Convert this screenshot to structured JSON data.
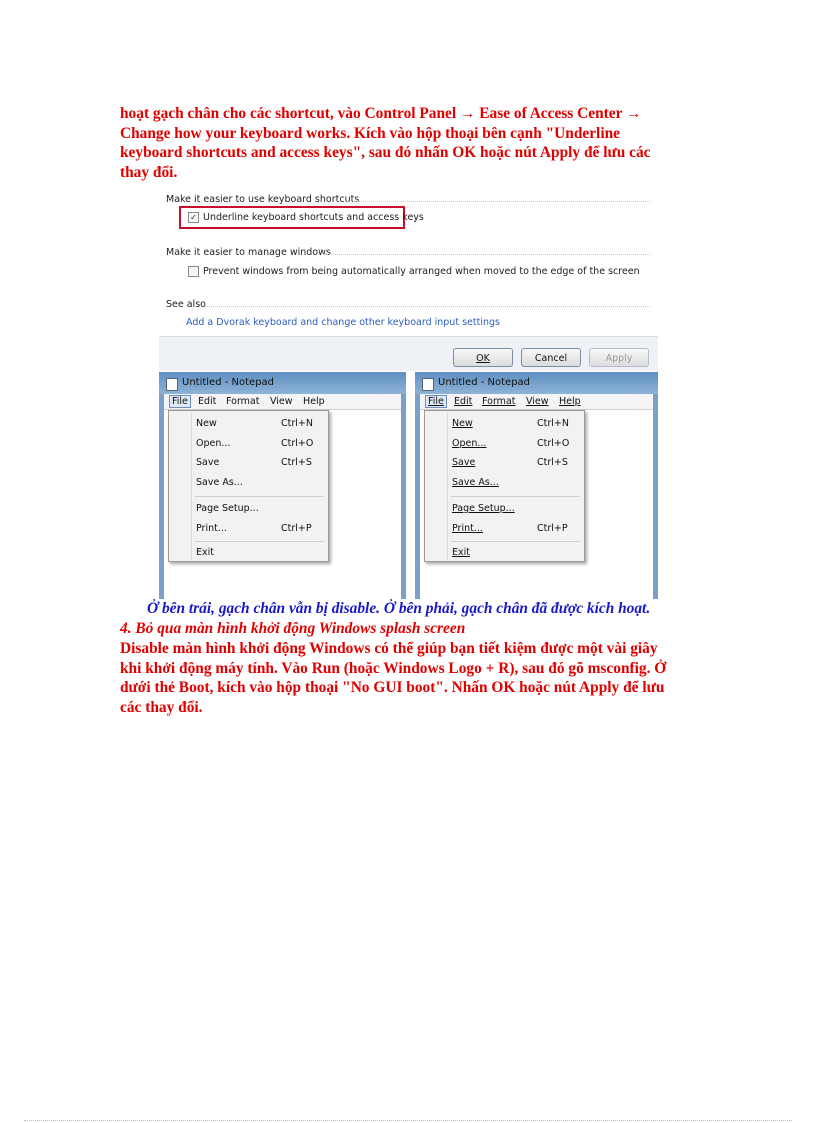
{
  "intro": {
    "line1": "hoạt gạch chân cho các shortcut, vào Control Panel → Ease of Access Center →",
    "line2": "Change how your keyboard works. Kích vào hộp thoại bên cạnh \"Underline",
    "line3": "keyboard shortcuts and access keys\", sau đó nhấn OK hoặc nút Apply để lưu các",
    "line4": "thay đổi."
  },
  "dialog": {
    "section1": "Make it easier to use keyboard shortcuts",
    "option1": "Underline keyboard shortcuts and access keys",
    "option1_checked": true,
    "section2": "Make it easier to manage windows",
    "option2": "Prevent windows from being automatically arranged when moved to the edge of the screen",
    "option2_checked": false,
    "section3": "See also",
    "link": "Add a Dvorak keyboard and change other keyboard input settings",
    "ok": "OK",
    "cancel": "Cancel",
    "apply": "Apply",
    "highlight_color": "#c8102e"
  },
  "notepad_left": {
    "title": "Untitled - Notepad",
    "menubar": [
      "File",
      "Edit",
      "Format",
      "View",
      "Help"
    ],
    "items": [
      {
        "label": "New",
        "shortcut": "Ctrl+N"
      },
      {
        "label": "Open...",
        "shortcut": "Ctrl+O"
      },
      {
        "label": "Save",
        "shortcut": "Ctrl+S"
      },
      {
        "label": "Save As...",
        "shortcut": ""
      },
      {
        "label": "Page Setup...",
        "shortcut": ""
      },
      {
        "label": "Print...",
        "shortcut": "Ctrl+P"
      },
      {
        "label": "Exit",
        "shortcut": ""
      }
    ]
  },
  "notepad_right": {
    "title": "Untitled - Notepad",
    "menubar": [
      "File",
      "Edit",
      "Format",
      "View",
      "Help"
    ],
    "items": [
      {
        "label": "New",
        "shortcut": "Ctrl+N"
      },
      {
        "label": "Open...",
        "shortcut": "Ctrl+O"
      },
      {
        "label": "Save",
        "shortcut": "Ctrl+S"
      },
      {
        "label": "Save As...",
        "shortcut": ""
      },
      {
        "label": "Page Setup...",
        "shortcut": ""
      },
      {
        "label": "Print...",
        "shortcut": "Ctrl+P"
      },
      {
        "label": "Exit",
        "shortcut": ""
      }
    ]
  },
  "caption": "Ở bên trái, gạch chân vẫn bị disable. Ở bên phải, gạch chân đã được kích hoạt.",
  "heading": "4. Bỏ qua màn hình khởi động Windows splash screen",
  "body": {
    "line1": "Disable màn hình khởi động Windows có thể giúp bạn tiết kiệm được một vài giây",
    "line2": "khi khởi động máy tính. Vào Run (hoặc Windows Logo + R), sau đó gõ msconfig. Ở",
    "line3": "dưới thẻ Boot, kích vào hộp thoại \"No GUI boot\". Nhấn OK hoặc nút Apply để lưu",
    "line4": "các thay đổi."
  },
  "colors": {
    "body_text": "#e00000",
    "caption_text": "#1818c8",
    "link": "#2a5ebf",
    "titlebar": "#6d9cc9"
  }
}
